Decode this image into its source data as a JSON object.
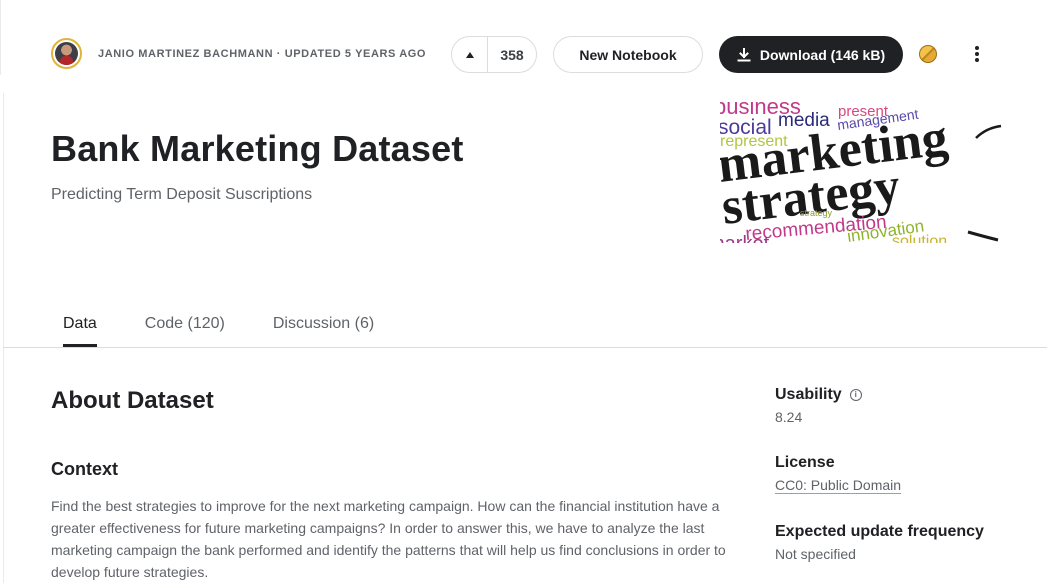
{
  "header": {
    "author_line": "JANIO MARTINEZ BACHMANN · UPDATED 5 YEARS AGO",
    "upvote_count": "358",
    "new_notebook_label": "New Notebook",
    "download_label": "Download (146 kB)"
  },
  "dataset": {
    "title": "Bank Marketing Dataset",
    "subtitle": "Predicting Term Deposit Suscriptions"
  },
  "cover": {
    "words": [
      "business",
      "social",
      "media",
      "present",
      "management",
      "represent",
      "marketing",
      "strategy",
      "strategy",
      "recommendation",
      "innovation",
      "solution",
      "market"
    ]
  },
  "tabs": [
    {
      "label": "Data",
      "active": true
    },
    {
      "label": "Code (120)",
      "active": false
    },
    {
      "label": "Discussion (6)",
      "active": false
    }
  ],
  "about": {
    "heading": "About Dataset",
    "context_heading": "Context",
    "paragraph": "Find the best strategies to improve for the next marketing campaign. How can the financial institution have a greater effectiveness for future marketing campaigns? In order to answer this, we have to analyze the last marketing campaign the bank performed and identify the patterns that will help us find conclusions in order to develop future strategies."
  },
  "meta": {
    "usability_label": "Usability",
    "usability_value": "8.24",
    "license_label": "License",
    "license_value": "CC0: Public Domain",
    "frequency_label": "Expected update frequency",
    "frequency_value": "Not specified"
  },
  "icons": {
    "upvote": "caret-up-icon",
    "download": "download-icon",
    "medal": "medal-icon",
    "more": "more-vert-icon",
    "info": "info-icon"
  }
}
